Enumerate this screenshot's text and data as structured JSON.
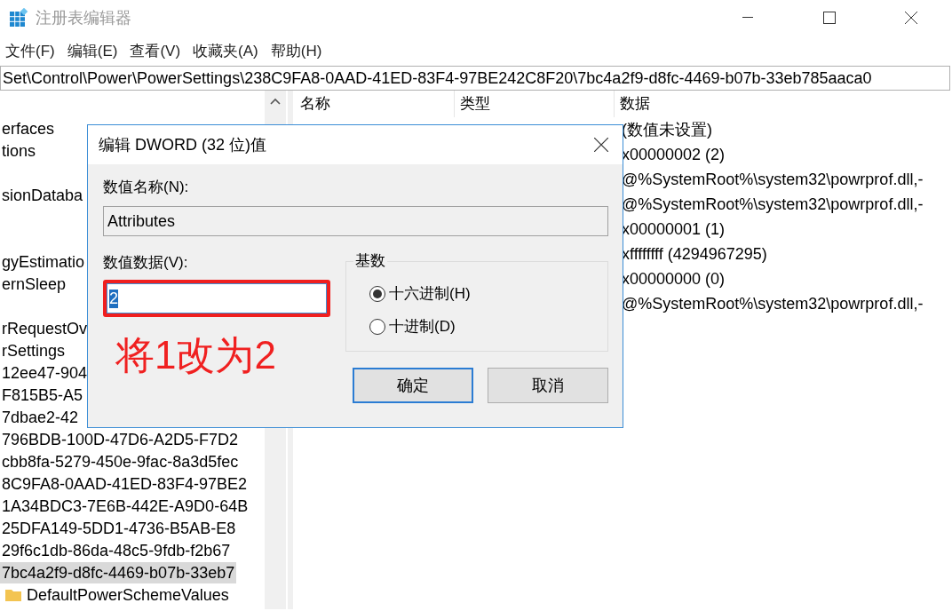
{
  "window": {
    "title": "注册表编辑器"
  },
  "menu": [
    "文件(F)",
    "编辑(E)",
    "查看(V)",
    "收藏夹(A)",
    "帮助(H)"
  ],
  "address": "Set\\Control\\Power\\PowerSettings\\238C9FA8-0AAD-41ED-83F4-97BE242C8F20\\7bc4a2f9-d8fc-4469-b07b-33eb785aaca0",
  "tree": [
    {
      "kind": "key",
      "label": "erfaces",
      "selected": false
    },
    {
      "kind": "key",
      "label": "tions",
      "selected": false
    },
    {
      "kind": "covered"
    },
    {
      "kind": "key",
      "label": "sionDataba",
      "selected": false
    },
    {
      "kind": "covered"
    },
    {
      "kind": "covered"
    },
    {
      "kind": "key",
      "label": "gyEstimatio",
      "selected": false
    },
    {
      "kind": "key",
      "label": "ernSleep",
      "selected": false
    },
    {
      "kind": "covered"
    },
    {
      "kind": "key",
      "label": "rRequestOv",
      "selected": false
    },
    {
      "kind": "key",
      "label": "rSettings",
      "selected": false
    },
    {
      "kind": "key",
      "label": "12ee47-904",
      "selected": false
    },
    {
      "kind": "key",
      "label": "F815B5-A5",
      "selected": false
    },
    {
      "kind": "key",
      "label": "7dbae2-42",
      "selected": false
    },
    {
      "kind": "key",
      "label": "796BDB-100D-47D6-A2D5-F7D2",
      "selected": false
    },
    {
      "kind": "key",
      "label": "cbb8fa-5279-450e-9fac-8a3d5fec",
      "selected": false
    },
    {
      "kind": "key",
      "label": "8C9FA8-0AAD-41ED-83F4-97BE2",
      "selected": false
    },
    {
      "kind": "key",
      "label": "1A34BDC3-7E6B-442E-A9D0-64B",
      "selected": false
    },
    {
      "kind": "key",
      "label": "25DFA149-5DD1-4736-B5AB-E8",
      "selected": false
    },
    {
      "kind": "key",
      "label": "29f6c1db-86da-48c5-9fdb-f2b67",
      "selected": false
    },
    {
      "kind": "key",
      "label": "7bc4a2f9-d8fc-4469-b07b-33eb7",
      "selected": true
    },
    {
      "kind": "folder",
      "label": "DefaultPowerSchemeValues",
      "selected": false
    }
  ],
  "table": {
    "columns": [
      "名称",
      "类型",
      "数据"
    ],
    "rows": [
      {
        "data": "(数值未设置)"
      },
      {
        "data": "x00000002 (2)"
      },
      {
        "data": "@%SystemRoot%\\system32\\powrprof.dll,-"
      },
      {
        "data": "@%SystemRoot%\\system32\\powrprof.dll,-"
      },
      {
        "data": "x00000001 (1)"
      },
      {
        "data": "xffffffff (4294967295)"
      },
      {
        "data": "x00000000 (0)"
      },
      {
        "data": "@%SystemRoot%\\system32\\powrprof.dll,-"
      }
    ]
  },
  "dialog": {
    "title": "编辑 DWORD (32 位)值",
    "name_label": "数值名称(N):",
    "name_value": "Attributes",
    "data_label": "数值数据(V):",
    "data_value": "2",
    "data_value_selected": true,
    "base_label": "基数",
    "bases": [
      {
        "label": "十六进制(H)",
        "selected": true
      },
      {
        "label": "十进制(D)",
        "selected": false
      }
    ],
    "buttons": [
      {
        "label": "确定",
        "default": true
      },
      {
        "label": "取消",
        "default": false
      }
    ],
    "annotation": "将1改为2"
  }
}
